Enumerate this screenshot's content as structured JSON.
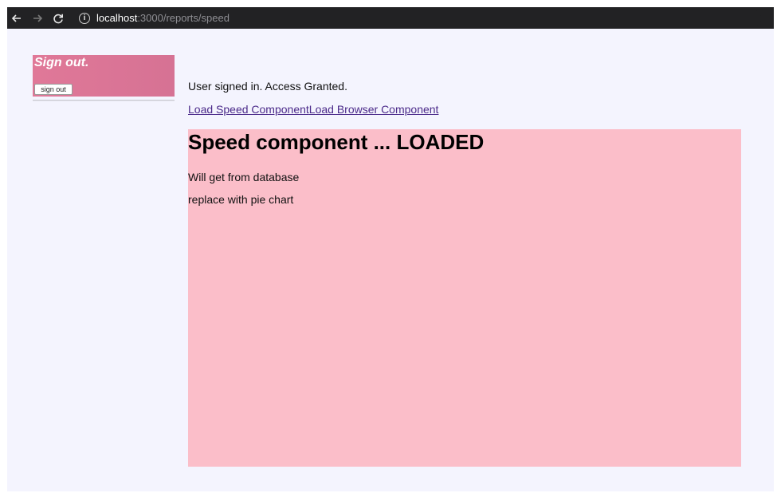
{
  "browser": {
    "url_host": "localhost",
    "url_path": ":3000/reports/speed"
  },
  "signout": {
    "title": "Sign out.",
    "button_label": "sign out"
  },
  "status": "User signed in. Access Granted.",
  "links": {
    "speed": "Load Speed Component",
    "browser": "Load Browser Component"
  },
  "speed_component": {
    "title": "Speed component ... LOADED",
    "line1": "Will get from database",
    "line2": "replace with pie chart"
  },
  "colors": {
    "panel": "#fbbec9",
    "signout_box": "#dd7596",
    "page_bg": "#f4f4fe"
  }
}
